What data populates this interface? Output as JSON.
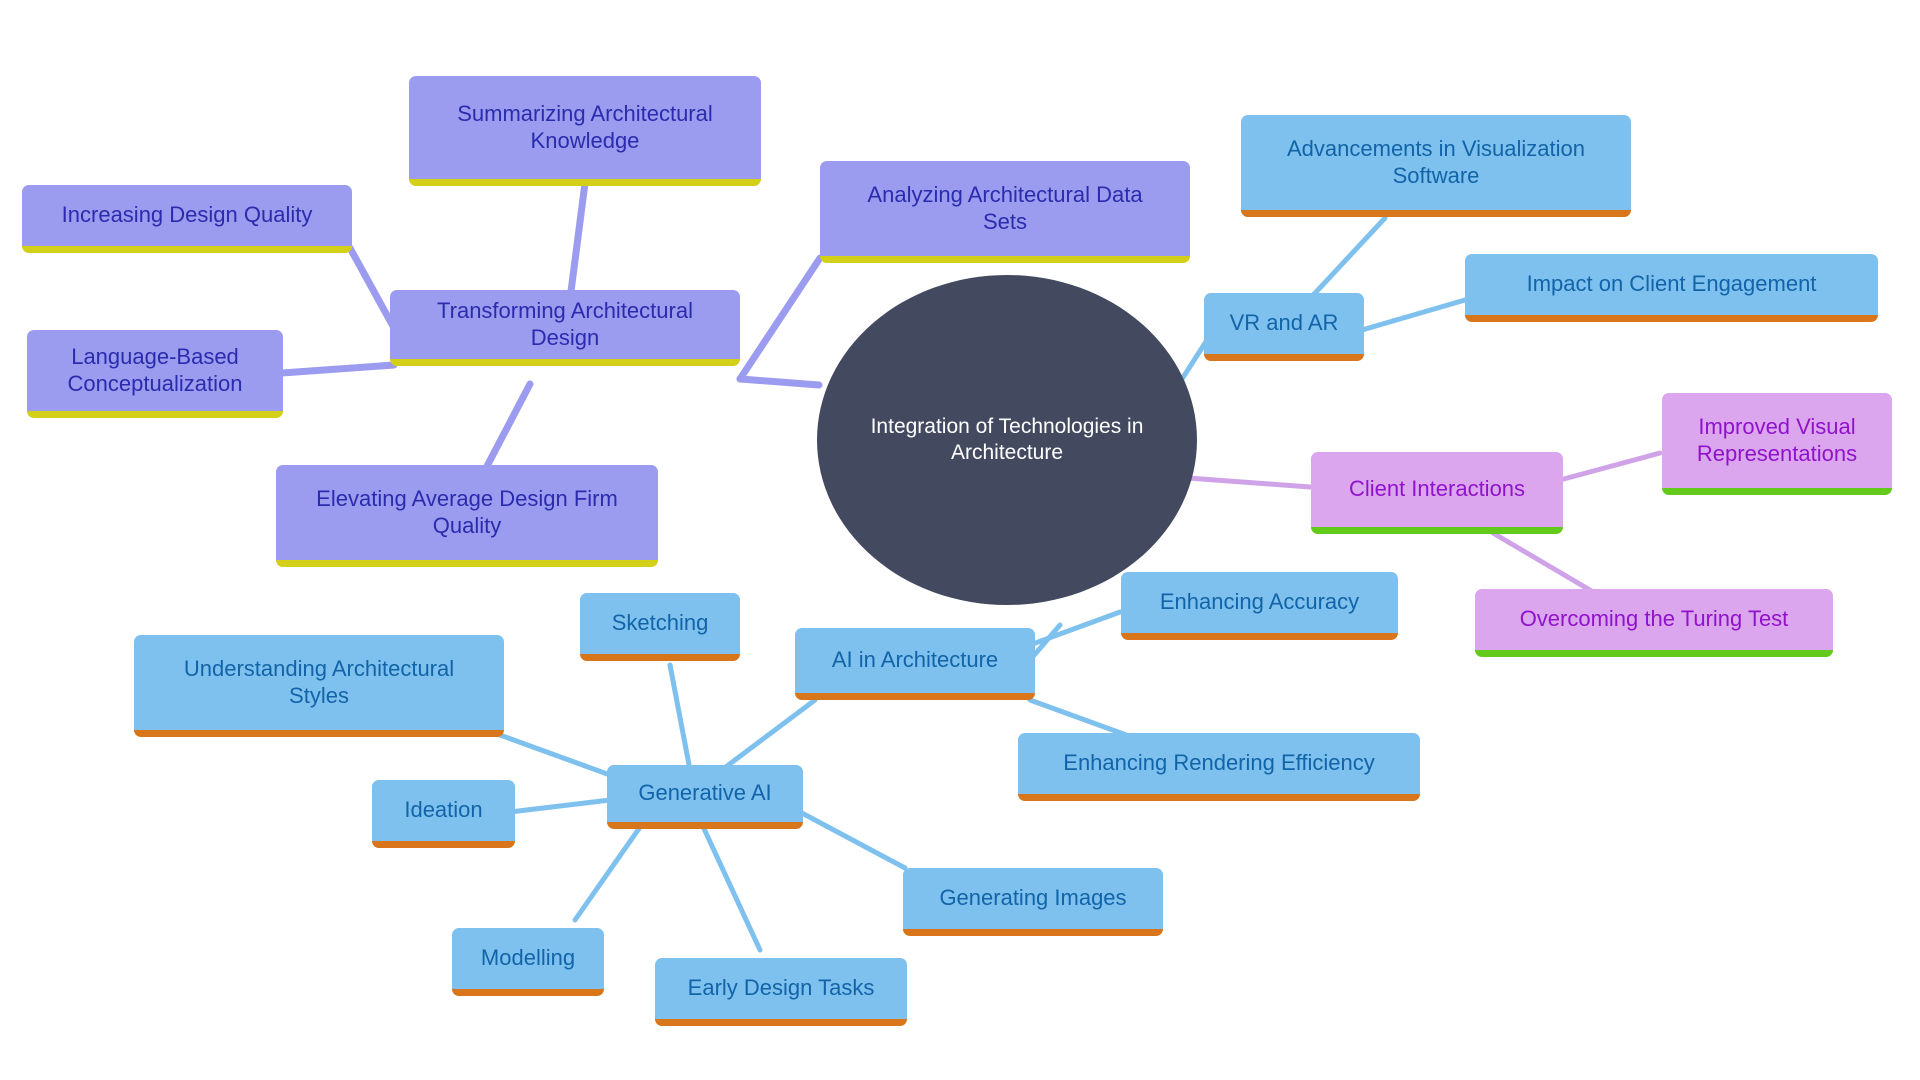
{
  "diagram": {
    "title": "Integration of Technologies in Architecture",
    "type": "mindmap",
    "background_color": "#ffffff"
  },
  "root": {
    "label": "Integration of Technologies in\nArchitecture",
    "fill": "#434A60",
    "text_color": "#ffffff"
  },
  "branches": {
    "purple": {
      "fill": "#9B9CEF",
      "text_color": "#2B2BAE",
      "underline_color": "#D4CF18"
    },
    "blue": {
      "fill": "#7FC1EE",
      "text_color": "#1264A8",
      "underline_color": "#D9761B"
    },
    "magenta": {
      "fill": "#DBA6EE",
      "text_color": "#9013CB",
      "underline_color": "#63C91B"
    }
  },
  "nodes": {
    "transforming_architectural_design": "Transforming Architectural\nDesign",
    "summarizing_architectural_knowledge": "Summarizing Architectural\nKnowledge",
    "increasing_design_quality": "Increasing Design Quality",
    "language_based_conceptualization": "Language-Based\nConceptualization",
    "elevating_average_design_firm_quality": "Elevating Average Design Firm\nQuality",
    "analyzing_architectural_data_sets": "Analyzing Architectural Data\nSets",
    "vr_and_ar": "VR and AR",
    "advancements_in_visualization_software": "Advancements in Visualization\nSoftware",
    "impact_on_client_engagement": "Impact on Client Engagement",
    "client_interactions": "Client Interactions",
    "improved_visual_representations": "Improved Visual\nRepresentations",
    "overcoming_the_turing_test": "Overcoming the Turing Test",
    "ai_in_architecture": "AI in Architecture",
    "enhancing_accuracy": "Enhancing Accuracy",
    "enhancing_rendering_efficiency": "Enhancing Rendering Efficiency",
    "generative_ai": "Generative AI",
    "sketching": "Sketching",
    "understanding_architectural_styles": "Understanding Architectural\nStyles",
    "ideation": "Ideation",
    "modelling": "Modelling",
    "early_design_tasks": "Early Design Tasks",
    "generating_images": "Generating Images"
  }
}
